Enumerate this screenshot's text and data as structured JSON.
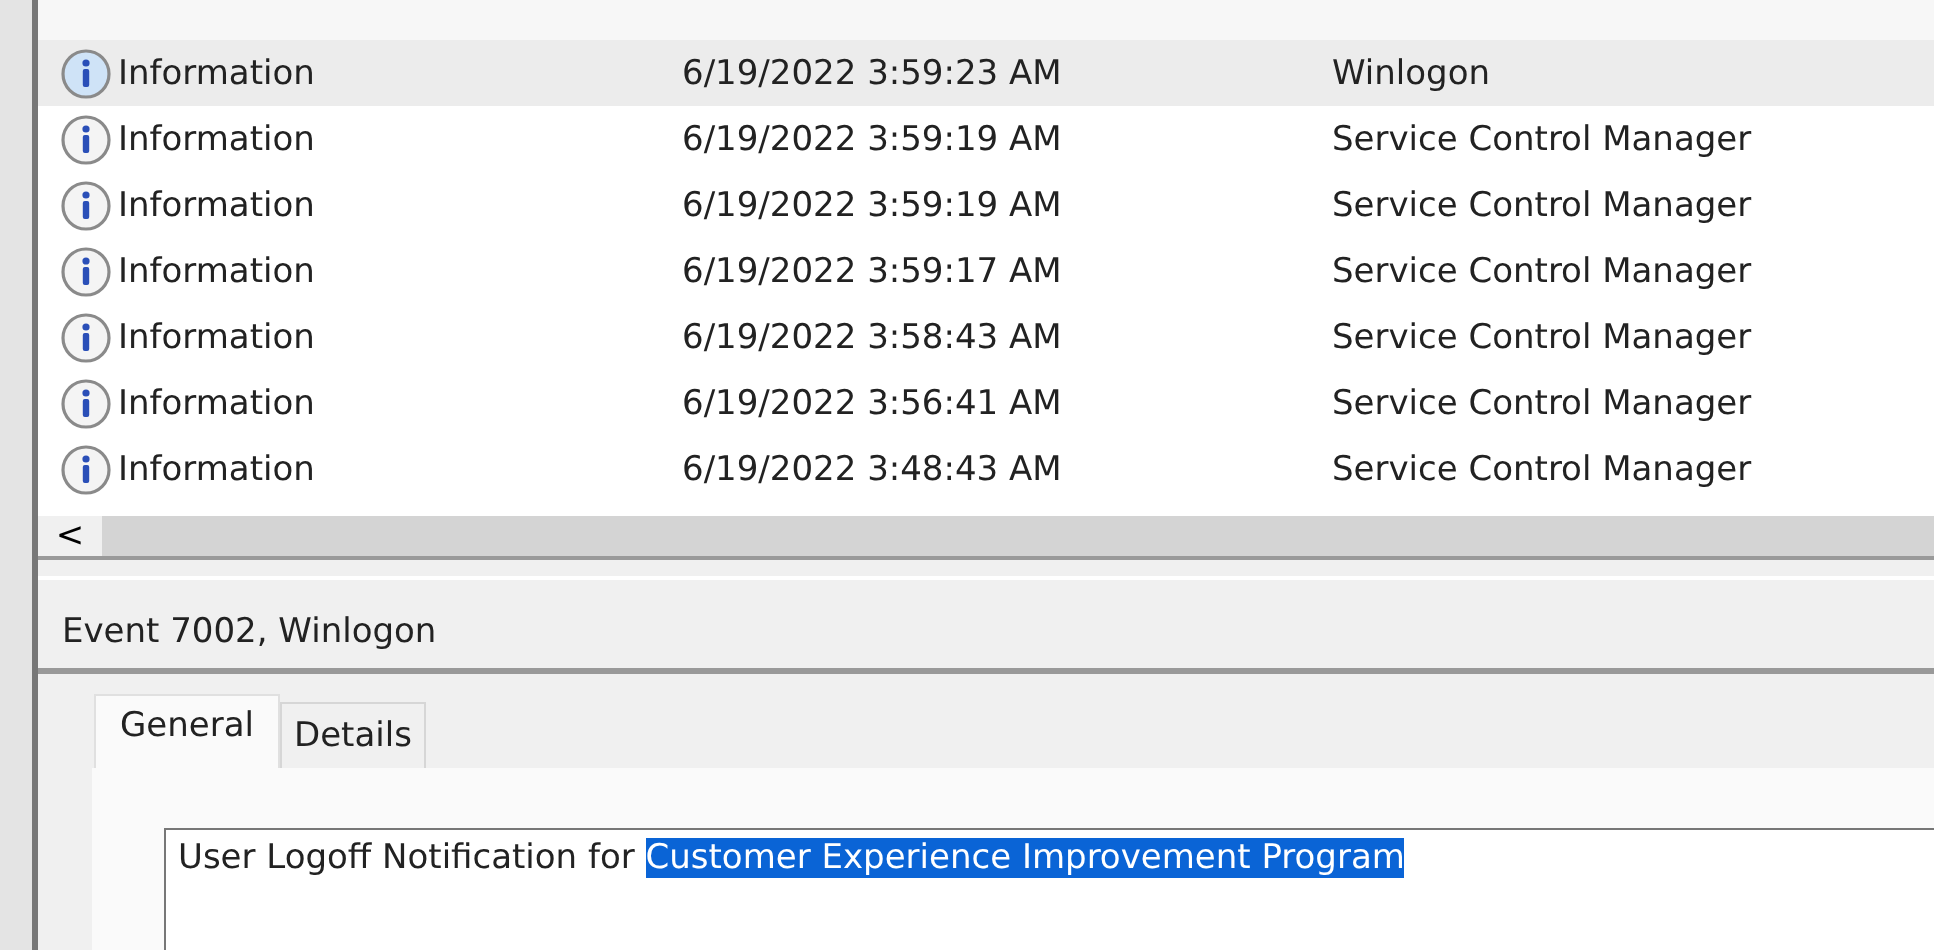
{
  "events": {
    "rows": [
      {
        "level": "Information",
        "date": "6/19/2022 3:59:23 AM",
        "source": "Winlogon",
        "selected": true
      },
      {
        "level": "Information",
        "date": "6/19/2022 3:59:19 AM",
        "source": "Service Control Manager",
        "selected": false
      },
      {
        "level": "Information",
        "date": "6/19/2022 3:59:19 AM",
        "source": "Service Control Manager",
        "selected": false
      },
      {
        "level": "Information",
        "date": "6/19/2022 3:59:17 AM",
        "source": "Service Control Manager",
        "selected": false
      },
      {
        "level": "Information",
        "date": "6/19/2022 3:58:43 AM",
        "source": "Service Control Manager",
        "selected": false
      },
      {
        "level": "Information",
        "date": "6/19/2022 3:56:41 AM",
        "source": "Service Control Manager",
        "selected": false
      },
      {
        "level": "Information",
        "date": "6/19/2022 3:48:43 AM",
        "source": "Service Control Manager",
        "selected": false
      }
    ],
    "scroll_left_button": "<"
  },
  "detail": {
    "title": "Event 7002, Winlogon",
    "tabs": [
      {
        "label": "General",
        "selected": true
      },
      {
        "label": "Details",
        "selected": false
      }
    ],
    "message": {
      "text": "User Logoff Notification for ",
      "selected_text": "Customer Experience Improvement Program"
    }
  }
}
